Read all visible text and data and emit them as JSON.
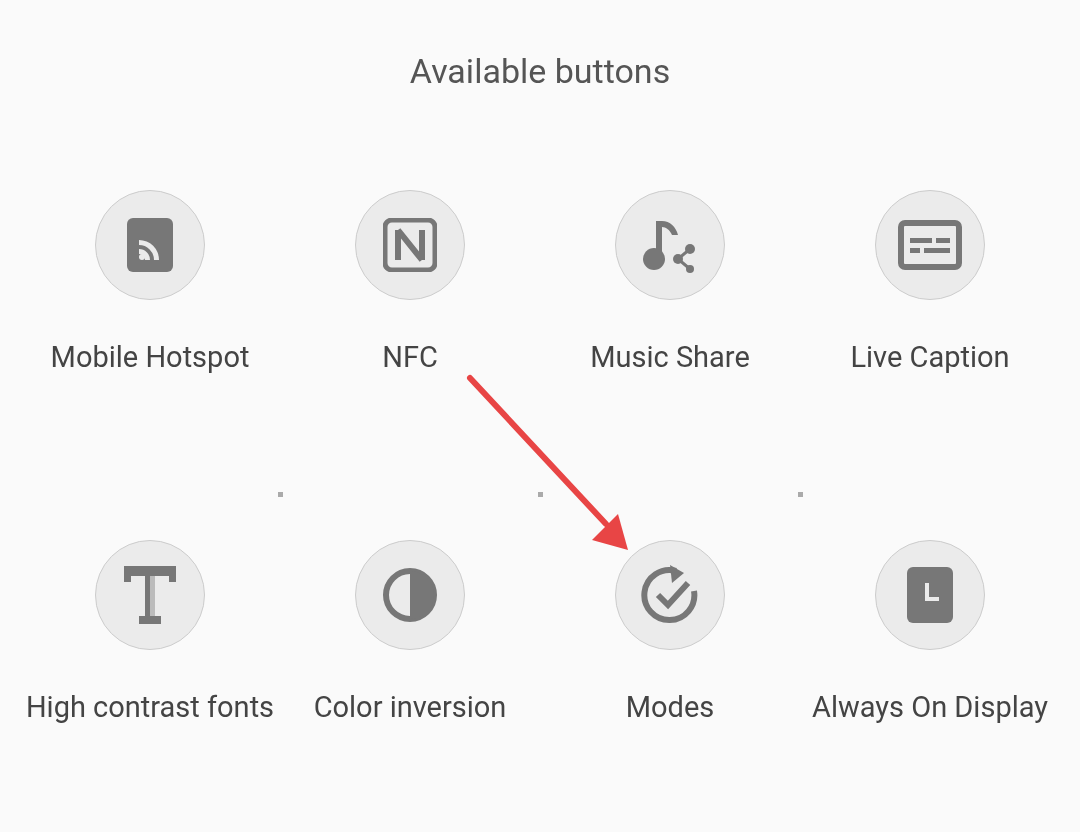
{
  "title": "Available buttons",
  "buttons": [
    {
      "kind": "hotspot",
      "label": "Mobile Hotspot"
    },
    {
      "kind": "nfc",
      "label": "NFC"
    },
    {
      "kind": "music",
      "label": "Music Share"
    },
    {
      "kind": "caption",
      "label": "Live Caption"
    },
    {
      "kind": "fonts",
      "label": "High contrast fonts"
    },
    {
      "kind": "inversion",
      "label": "Color inversion"
    },
    {
      "kind": "modes",
      "label": "Modes"
    },
    {
      "kind": "aod",
      "label": "Always On Display"
    }
  ]
}
